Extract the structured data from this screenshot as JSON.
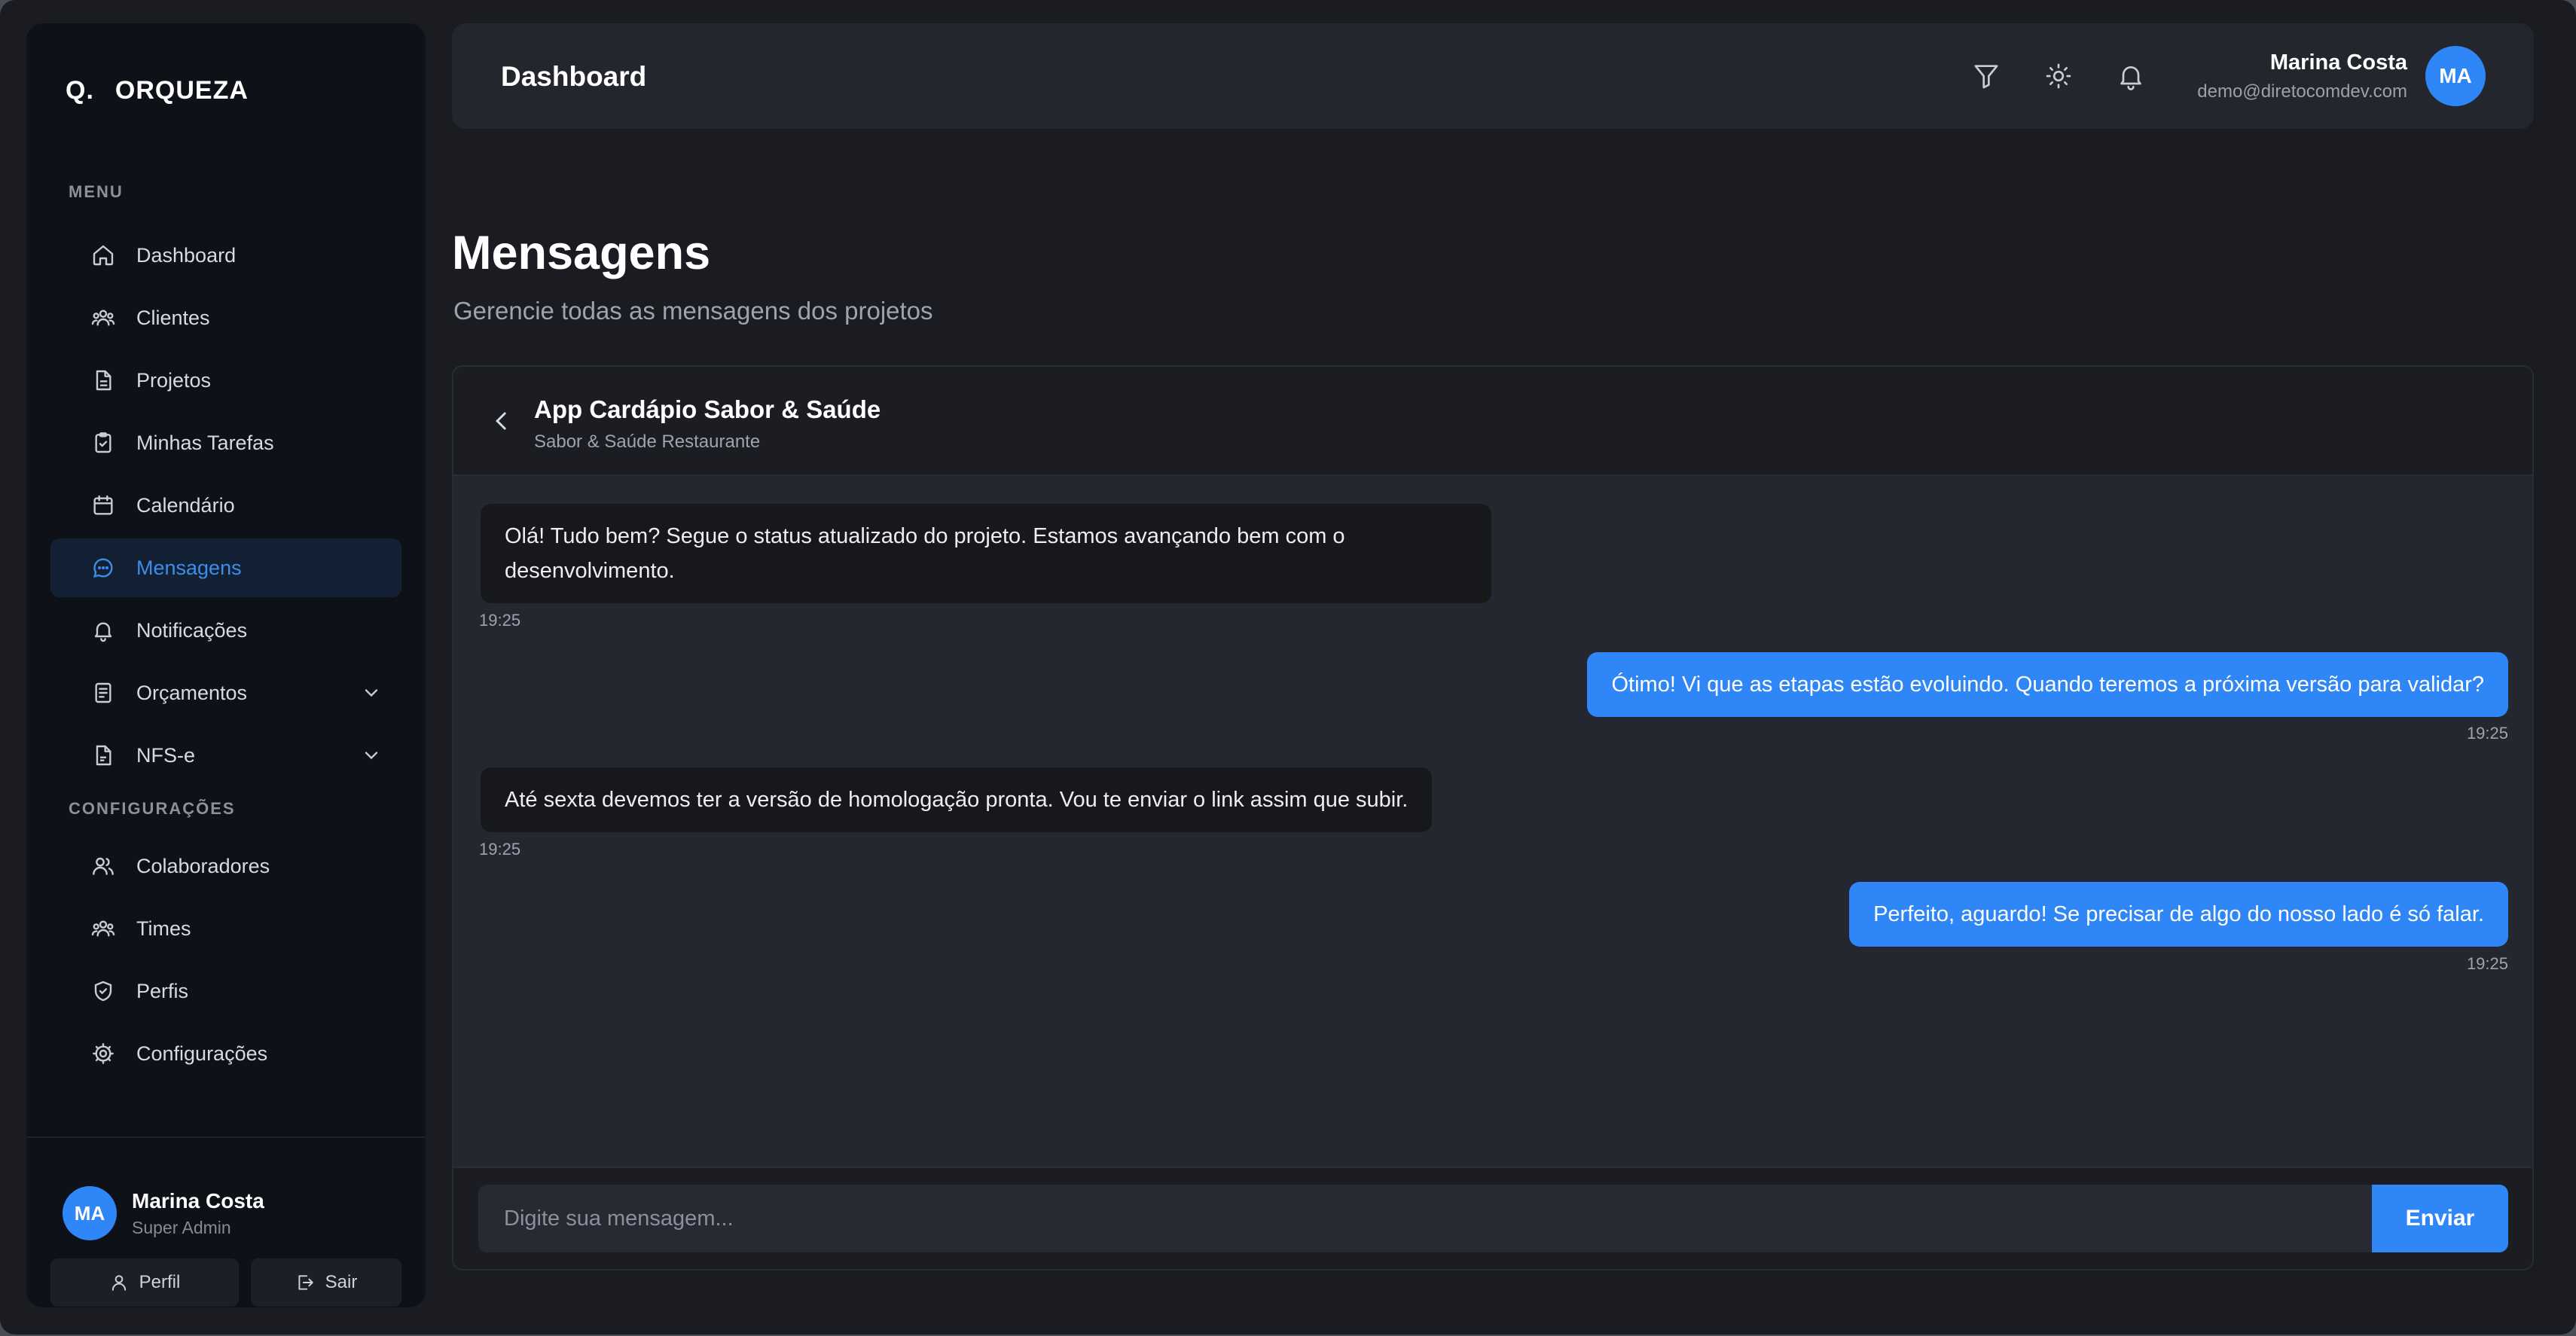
{
  "brand": {
    "mark": "Q.",
    "name": "ORQUEZA"
  },
  "sidebar": {
    "menu_label": "MENU",
    "items": [
      {
        "label": "Dashboard",
        "icon": "home-icon"
      },
      {
        "label": "Clientes",
        "icon": "users-icon"
      },
      {
        "label": "Projetos",
        "icon": "file-icon"
      },
      {
        "label": "Minhas Tarefas",
        "icon": "clipboard-check-icon"
      },
      {
        "label": "Calendário",
        "icon": "calendar-icon"
      },
      {
        "label": "Mensagens",
        "icon": "message-icon",
        "active": true
      },
      {
        "label": "Notificações",
        "icon": "bell-icon"
      },
      {
        "label": "Orçamentos",
        "icon": "receipt-icon",
        "expandable": true
      },
      {
        "label": "NFS-e",
        "icon": "document-icon",
        "expandable": true
      }
    ],
    "config_label": "CONFIGURAÇÕES",
    "config_items": [
      {
        "label": "Colaboradores",
        "icon": "user-group-icon"
      },
      {
        "label": "Times",
        "icon": "team-icon"
      },
      {
        "label": "Perfis",
        "icon": "shield-icon"
      },
      {
        "label": "Configurações",
        "icon": "gear-icon"
      }
    ],
    "user": {
      "initials": "MA",
      "name": "Marina Costa",
      "role": "Super Admin"
    },
    "profile_button": "Perfil",
    "logout_button": "Sair"
  },
  "header": {
    "title": "Dashboard",
    "icons": [
      "filter-icon",
      "sun-icon",
      "bell-icon"
    ],
    "user": {
      "name": "Marina Costa",
      "email": "demo@diretocomdev.com",
      "initials": "MA"
    }
  },
  "page": {
    "title": "Mensagens",
    "subtitle": "Gerencie todas as mensagens dos projetos"
  },
  "chat": {
    "title": "App Cardápio Sabor & Saúde",
    "subtitle": "Sabor & Saúde Restaurante",
    "messages": [
      {
        "direction": "in",
        "text": "Olá! Tudo bem? Segue o status atualizado do projeto. Estamos avançando bem com o desenvolvimento.",
        "time": "19:25"
      },
      {
        "direction": "out",
        "text": "Ótimo! Vi que as etapas estão evoluindo. Quando teremos a próxima versão para validar?",
        "time": "19:25"
      },
      {
        "direction": "in",
        "text": "Até sexta devemos ter a versão de homologação pronta. Vou te enviar o link assim que subir.",
        "time": "19:25"
      },
      {
        "direction": "out",
        "text": "Perfeito, aguardo! Se precisar de algo do nosso lado é só falar.",
        "time": "19:25"
      }
    ],
    "input_placeholder": "Digite sua mensagem...",
    "send_label": "Enviar"
  },
  "colors": {
    "accent": "#2f86f6",
    "active_bg": "#132034",
    "background": "#1b1c21",
    "sidebar": "#0e1117"
  }
}
